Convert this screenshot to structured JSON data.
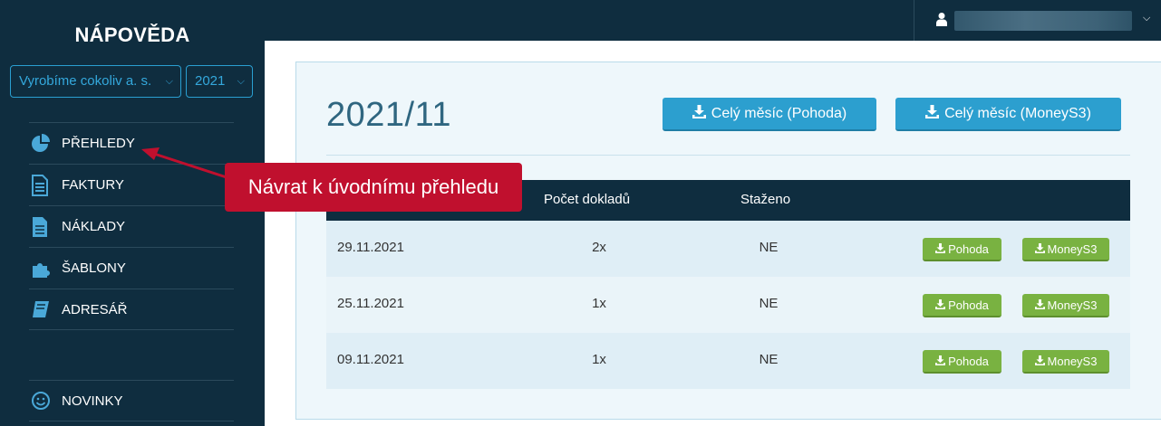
{
  "sidebar": {
    "brand": "NÁPOVĚDA",
    "company_select": "Vyrobíme cokoliv a. s.",
    "year_select": "2021",
    "items": [
      {
        "label": "PŘEHLEDY",
        "icon": "pie-chart-icon"
      },
      {
        "label": "FAKTURY",
        "icon": "document-icon"
      },
      {
        "label": "NÁKLADY",
        "icon": "file-icon"
      },
      {
        "label": "ŠABLONY",
        "icon": "puzzle-icon"
      },
      {
        "label": "ADRESÁŘ",
        "icon": "book-icon"
      }
    ],
    "bottom_item": {
      "label": "NOVINKY",
      "icon": "smiley-icon"
    }
  },
  "topbar": {
    "user_icon": "user-icon"
  },
  "main": {
    "month_title": "2021/11",
    "btn_pohoda_month": "Celý měsíc (Pohoda)",
    "btn_money_month": "Celý měsíc (MoneyS3)",
    "table": {
      "headers": {
        "count": "Počet dokladů",
        "downloaded": "Staženo"
      },
      "rows": [
        {
          "date": "29.11.2021",
          "count": "2x",
          "downloaded": "NE",
          "pohoda": "Pohoda",
          "money": "MoneyS3"
        },
        {
          "date": "25.11.2021",
          "count": "1x",
          "downloaded": "NE",
          "pohoda": "Pohoda",
          "money": "MoneyS3"
        },
        {
          "date": "09.11.2021",
          "count": "1x",
          "downloaded": "NE",
          "pohoda": "Pohoda",
          "money": "MoneyS3"
        }
      ]
    }
  },
  "callout": {
    "text": "Návrat k úvodnímu přehledu",
    "color": "#c0102e"
  },
  "colors": {
    "sidebar_bg": "#0f2d3f",
    "accent_blue": "#2c9fcf",
    "accent_green": "#79b241"
  }
}
